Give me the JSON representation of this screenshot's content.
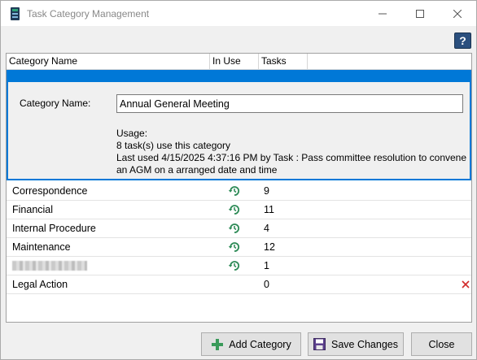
{
  "window": {
    "title": "Task Category Management",
    "help_label": "?"
  },
  "grid": {
    "columns": [
      "Category Name",
      "In Use",
      "Tasks"
    ],
    "editor": {
      "label": "Category Name:",
      "value": "Annual General Meeting",
      "usage_heading": "Usage:",
      "usage_count": "8 task(s) use this category",
      "usage_last_used": "Last used  4/15/2025 4:37:16 PM by Task : Pass committee resolution to convene",
      "usage_last_used_cont": "an AGM on a arranged date and time"
    },
    "rows": [
      {
        "name": "Correspondence",
        "in_use": true,
        "tasks": "9"
      },
      {
        "name": "Financial",
        "in_use": true,
        "tasks": "11"
      },
      {
        "name": "Internal Procedure",
        "in_use": true,
        "tasks": "4"
      },
      {
        "name": "Maintenance",
        "in_use": true,
        "tasks": "12"
      },
      {
        "name": "",
        "in_use": true,
        "tasks": "1",
        "redacted": true
      },
      {
        "name": "Legal Action",
        "in_use": false,
        "tasks": "0",
        "deletable": true
      }
    ]
  },
  "buttons": {
    "add": "Add Category",
    "save": "Save Changes",
    "close": "Close"
  },
  "colors": {
    "selection": "#0078d7",
    "in_use_icon": "#2e8b57",
    "delete_icon": "#d12a2a"
  }
}
